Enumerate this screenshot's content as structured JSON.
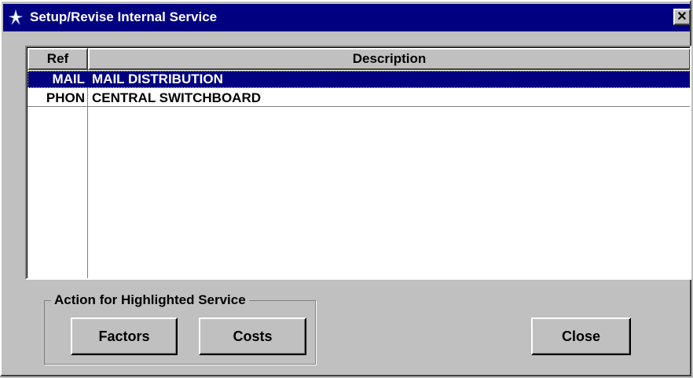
{
  "window": {
    "title": "Setup/Revise Internal Service",
    "close_label": "✕"
  },
  "list": {
    "headers": {
      "ref": "Ref",
      "description": "Description"
    },
    "rows": [
      {
        "ref": "MAIL",
        "description": "MAIL DISTRIBUTION",
        "selected": true
      },
      {
        "ref": "PHON",
        "description": "CENTRAL SWITCHBOARD",
        "selected": false
      }
    ]
  },
  "actions": {
    "group_label": "Action for Highlighted Service",
    "factors_label": "Factors",
    "costs_label": "Costs"
  },
  "close_button_label": "Close",
  "colors": {
    "titlebar": "#000080",
    "selection": "#000080",
    "face": "#c0c0c0"
  }
}
